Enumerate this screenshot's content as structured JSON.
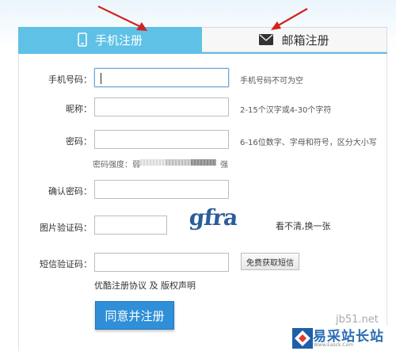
{
  "tabs": {
    "phone": {
      "label": "手机注册",
      "icon": "phone-icon"
    },
    "email": {
      "label": "邮箱注册",
      "icon": "envelope-icon"
    }
  },
  "form": {
    "phone": {
      "label": "手机号码：",
      "value": "",
      "hint": "手机号码不可为空"
    },
    "nickname": {
      "label": "昵称：",
      "value": "",
      "hint": "2-15个汉字或4-30个字符"
    },
    "password": {
      "label": "密码：",
      "value": "",
      "hint": "6-16位数字、字母和符号，区分大小写"
    },
    "strength": {
      "label": "密码强度：弱",
      "strong": "强"
    },
    "confirm": {
      "label": "确认密码：",
      "value": ""
    },
    "captcha": {
      "label": "图片验证码：",
      "value": "",
      "image_text": "gfra",
      "refresh": "看不清,换一张"
    },
    "sms": {
      "label": "短信验证码：",
      "value": "",
      "button": "免费获取短信"
    }
  },
  "agreement": {
    "terms": "优酷注册协议",
    "and": " 及 ",
    "copyright": "版权声明"
  },
  "submit": {
    "label": "同意并注册"
  },
  "watermark": {
    "site": "jb51.net",
    "title": "易采站长站",
    "url": "Www.Easck.Com"
  },
  "colors": {
    "accent": "#5fc1e6",
    "button": "#2f8fd8",
    "arrow": "#d22222"
  }
}
